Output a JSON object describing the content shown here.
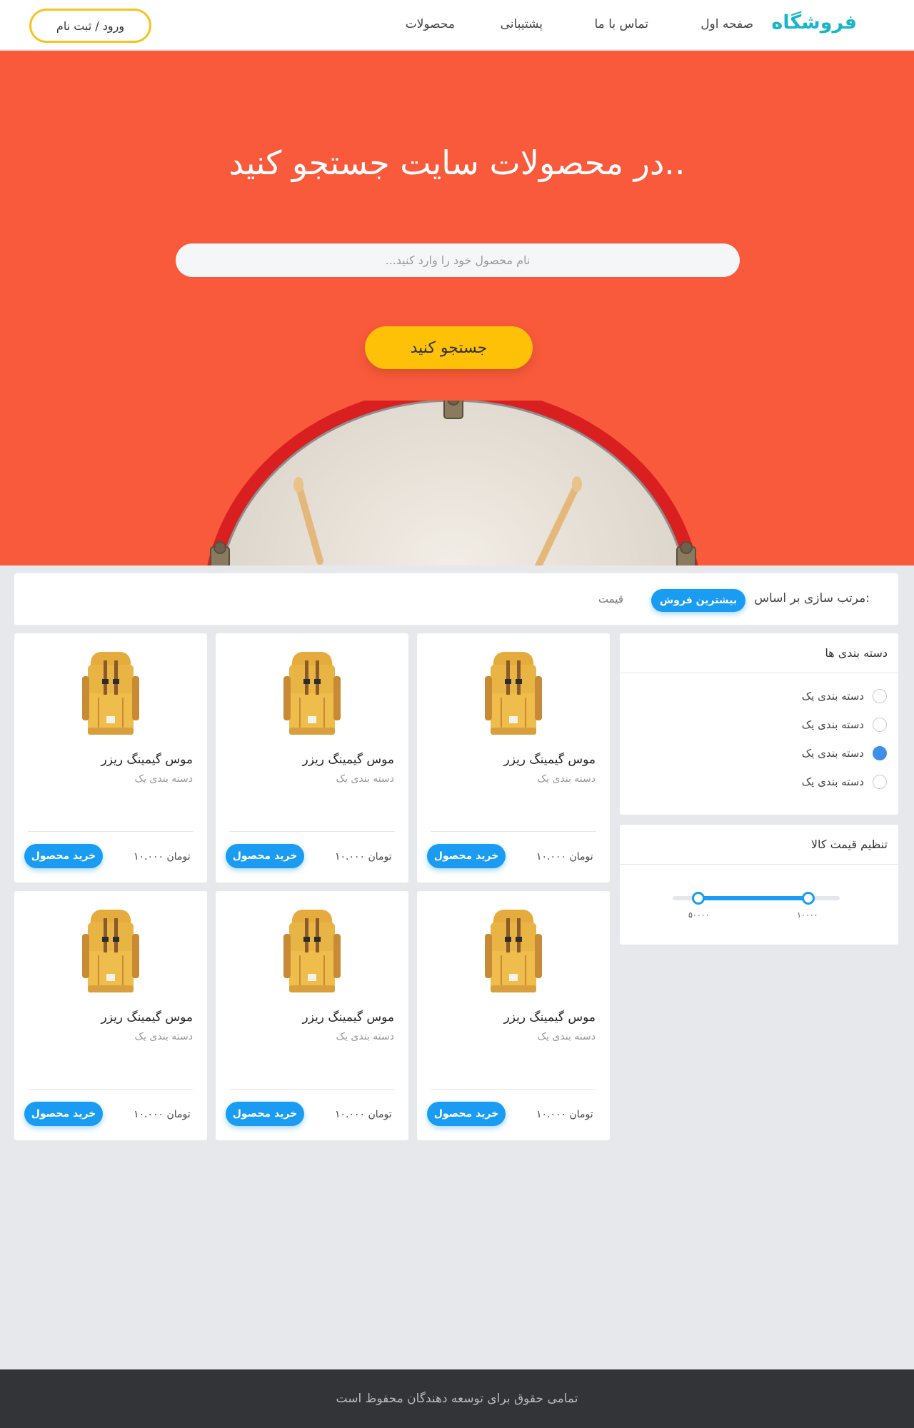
{
  "nav": {
    "brand": "فروشگاه",
    "links": [
      "صفحه اول",
      "تماس با ما",
      "پشتیبانی",
      "محصولات"
    ],
    "login_label": "ورود / ثبت نام"
  },
  "hero": {
    "title": "در محصولات سایت جستجو کنید..",
    "search_placeholder": "نام محصول خود را وارد کنید...",
    "search_button": "جستجو کنید"
  },
  "sort": {
    "label": "مرتب سازی بر اساس:",
    "active": "بیشترین فروش",
    "option": "قیمت"
  },
  "categories": {
    "title": "دسته بندی ها",
    "items": [
      {
        "label": "دسته بندی یک",
        "checked": false
      },
      {
        "label": "دسته بندی یک",
        "checked": false
      },
      {
        "label": "دسته بندی یک",
        "checked": true
      },
      {
        "label": "دسته بندی یک",
        "checked": false
      }
    ]
  },
  "price_filter": {
    "title": "تنظیم قیمت کالا",
    "min_label": "۵۰۰۰۰",
    "max_label": "۱۰۰۰۰"
  },
  "products": [
    {
      "title": "موس گیمینگ ریزر",
      "category": "دسته بندی یک",
      "price": "۱۰.۰۰۰ تومان",
      "buy": "خرید محصول"
    },
    {
      "title": "موس گیمینگ ریزر",
      "category": "دسته بندی یک",
      "price": "۱۰.۰۰۰ تومان",
      "buy": "خرید محصول"
    },
    {
      "title": "موس گیمینگ ریزر",
      "category": "دسته بندی یک",
      "price": "۱۰.۰۰۰ تومان",
      "buy": "خرید محصول"
    },
    {
      "title": "موس گیمینگ ریزر",
      "category": "دسته بندی یک",
      "price": "۱۰.۰۰۰ تومان",
      "buy": "خرید محصول"
    },
    {
      "title": "موس گیمینگ ریزر",
      "category": "دسته بندی یک",
      "price": "۱۰.۰۰۰ تومان",
      "buy": "خرید محصول"
    },
    {
      "title": "موس گیمینگ ریزر",
      "category": "دسته بندی یک",
      "price": "۱۰.۰۰۰ تومان",
      "buy": "خرید محصول"
    }
  ],
  "footer": {
    "text": "تمامی حقوق برای توسعه دهندگان محفوظ است"
  },
  "colors": {
    "hero": "#f95a3c",
    "brand": "#19b6c9",
    "accent_yellow": "#ffc107",
    "button_blue": "#1a9cf2"
  }
}
